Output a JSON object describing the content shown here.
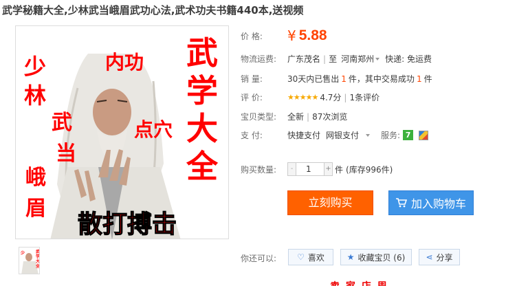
{
  "title": "武学秘籍大全,少林武当峨眉武功心法,武术功夫书籍440本,送视频",
  "image": {
    "side_text": "武学大全",
    "words": [
      "少",
      "林",
      "内功",
      "武",
      "当",
      "点穴",
      "峨",
      "眉"
    ],
    "bottom_text": "散打搏击",
    "thumb_text": "武学大全"
  },
  "price": {
    "label": "价    格:",
    "yen": "¥",
    "value": "5.88"
  },
  "logistics": {
    "label": "物流运费:",
    "from": "广东茂名",
    "sep": "|",
    "to_label": "至",
    "to": "河南郑州",
    "shipping": "快递: 免运费"
  },
  "sales": {
    "label": "销    量:",
    "prefix": "30天内已售出",
    "sold": "1",
    "unit1": "件，其中交易成功",
    "success": "1",
    "unit2": "件"
  },
  "rating": {
    "label": "评    价:",
    "stars": "★★★★★",
    "score": "4.7分",
    "sep": "|",
    "count": "1条评价"
  },
  "item_type": {
    "label": "宝贝类型:",
    "condition": "全新",
    "sep": "|",
    "views": "87次浏览"
  },
  "payment": {
    "label": "支    付:",
    "methods": [
      "快捷支付",
      "网银支付"
    ],
    "service_label": "服务:",
    "service_badge": "7"
  },
  "quantity": {
    "label": "购买数量:",
    "minus": "-",
    "value": "1",
    "plus": "+",
    "unit": "件",
    "stock": "(库存996件)"
  },
  "buttons": {
    "buy": "立刻购买",
    "cart": "加入购物车"
  },
  "share": {
    "label": "你还可以:",
    "like": "喜欢",
    "fav": "收藏宝贝 (6)",
    "share": "分享"
  },
  "bottom": {
    "text": "卖    家    店    周"
  },
  "colors": {
    "accent": "#ff4400",
    "buy": "#ff6100",
    "cart": "#3f95e8",
    "poster_red": "#ff0000"
  }
}
